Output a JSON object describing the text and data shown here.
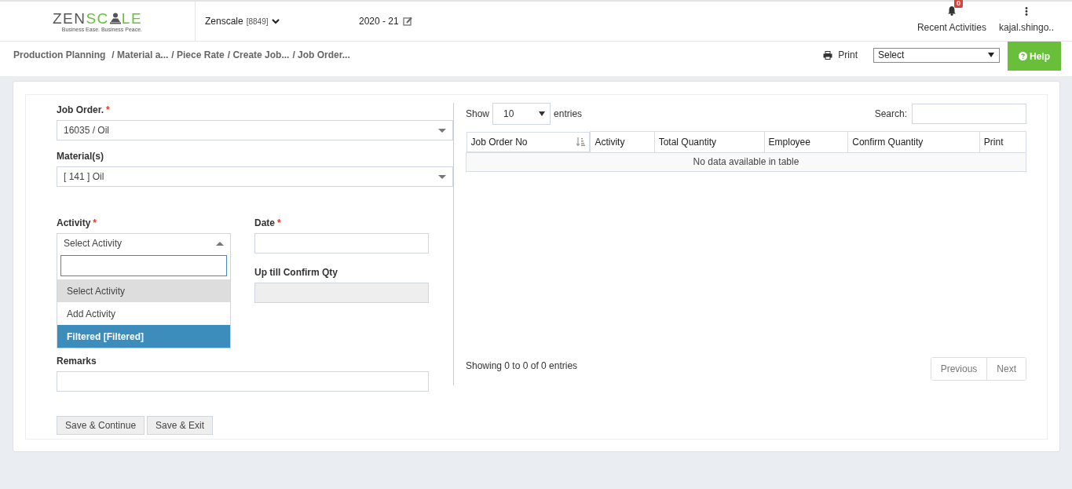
{
  "header": {
    "logo": {
      "left": "ZEN",
      "accent": "SC",
      "right": "LE",
      "tagline": "Business Ease. Business Peace."
    },
    "company": {
      "name": "Zenscale",
      "code": "[8849]"
    },
    "year": "2020 - 21",
    "notifications": {
      "label": "Recent Activities",
      "count": "0"
    },
    "user": "kajal.shingo.."
  },
  "breadcrumb": [
    "Production Planning",
    "/ Material a...",
    "/ Piece Rate",
    "/ Create Job...",
    "/ Job Order..."
  ],
  "toolbar": {
    "print": "Print",
    "select": {
      "value": "Select"
    },
    "help": "Help"
  },
  "form": {
    "job_order": {
      "label": "Job Order.",
      "required_mark": "*",
      "value": "16035 / Oil"
    },
    "materials": {
      "label": "Material(s)",
      "value": "[ 141 ] Oil"
    },
    "activity": {
      "label": "Activity",
      "required_mark": "*",
      "value": "Select Activity",
      "expanded": true,
      "options": [
        {
          "label": "Select Activity",
          "selected": true,
          "highlighted": false
        },
        {
          "label": "Add Activity",
          "selected": false,
          "highlighted": false
        },
        {
          "label": "Filtered [Filtered]",
          "selected": false,
          "highlighted": true
        }
      ]
    },
    "date": {
      "label": "Date",
      "required_mark": "*"
    },
    "confirm_qty": {
      "label": "Up till Confirm Qty",
      "disabled": true
    },
    "remarks": {
      "label": "Remarks"
    },
    "buttons": [
      "Save & Continue",
      "Save & Exit"
    ]
  },
  "table": {
    "show_label": "Show",
    "page_size": "10",
    "entries_label": "entries",
    "search_label": "Search:",
    "columns": [
      "Job Order No",
      "Activity",
      "Total Quantity",
      "Employee",
      "Confirm Quantity",
      "Print"
    ],
    "empty": "No data available in table",
    "info": "Showing 0 to 0 of 0 entries",
    "pager": [
      {
        "label": "Previous",
        "disabled": true
      },
      {
        "label": "Next",
        "disabled": true
      }
    ]
  }
}
